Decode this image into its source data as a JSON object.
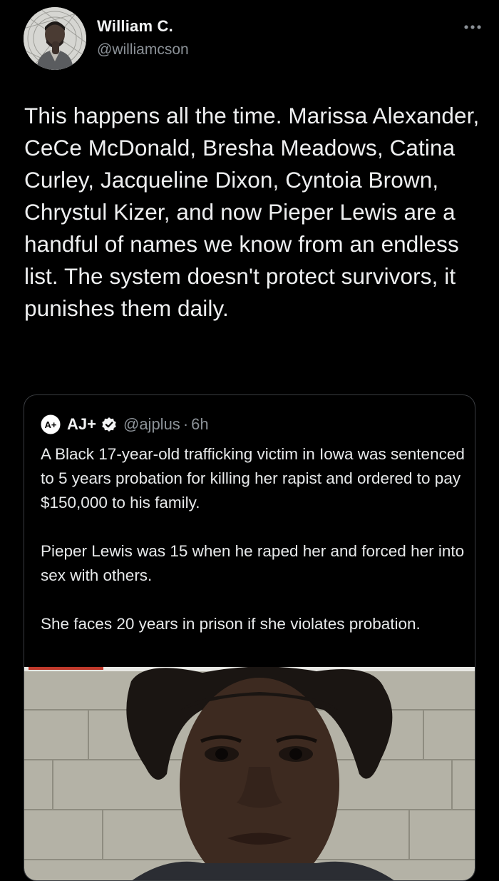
{
  "author": {
    "name": "William C.",
    "handle": "@williamcson",
    "avatar_icon": "profile-photo"
  },
  "tweet": {
    "text": "This happens all the time. Marissa Alexander, CeCe McDonald, Bresha Meadows, Catina Curley, Jacqueline Dixon, Cyntoia Brown, Chrystul Kizer, and now Pieper Lewis are a handful of names we know from an endless list. The system doesn't protect survivors, it punishes them daily."
  },
  "quoted": {
    "name": "AJ+",
    "handle": "@ajplus",
    "separator": "·",
    "time": "6h",
    "verified": true,
    "paragraphs": [
      "A Black 17-year-old trafficking victim in Iowa was sentenced to 5 years probation for killing her rapist and ordered to pay $150,000 to his family.",
      "Pieper Lewis was 15 when he raped her and forced her into sex with others.",
      "She faces 20 years in prison if she violates probation."
    ],
    "media_icon": "photo"
  },
  "colors": {
    "background": "#000000",
    "text": "#e7e9ea",
    "secondary": "#8b9197",
    "border": "#3a3d41",
    "verified": "#f2f3f4"
  }
}
